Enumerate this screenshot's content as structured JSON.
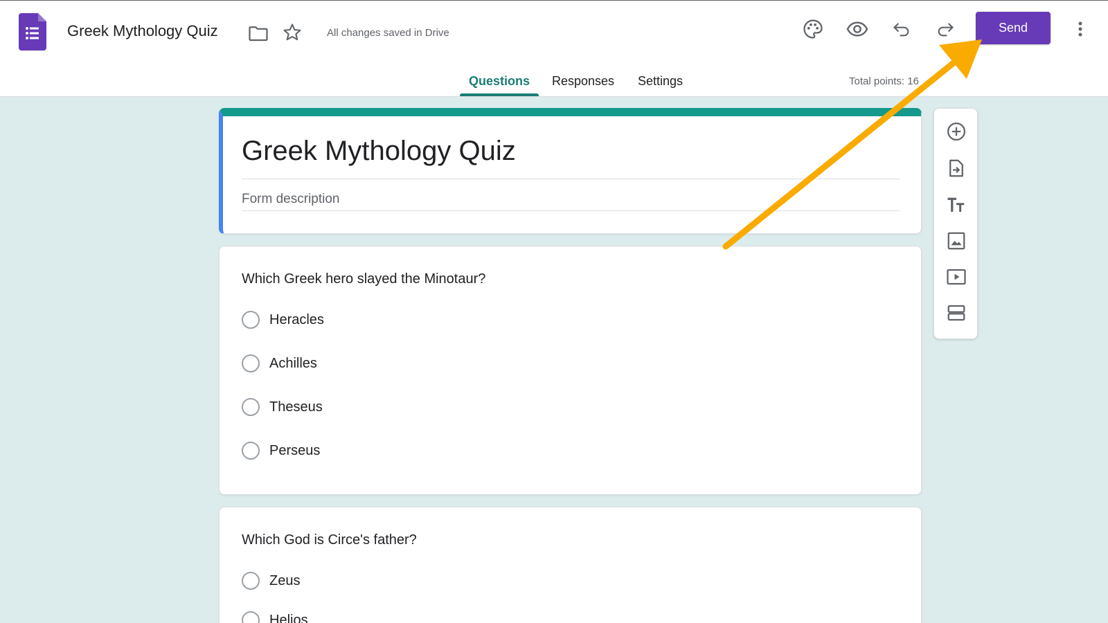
{
  "app": {
    "doc_title": "Greek Mythology Quiz",
    "save_status": "All changes saved in Drive",
    "send_label": "Send",
    "brand_color": "#673ab7",
    "accent_color": "#1a7d74",
    "toolbar_icons": [
      "palette-icon",
      "preview-eye-icon",
      "undo-icon",
      "redo-icon",
      "more-vert-icon"
    ]
  },
  "tabs": {
    "questions": "Questions",
    "responses": "Responses",
    "settings": "Settings",
    "active": "Questions",
    "total_points": "Total points: 16"
  },
  "form": {
    "title": "Greek Mythology Quiz",
    "description_placeholder": "Form description"
  },
  "questions": [
    {
      "text": "Which Greek hero slayed the Minotaur?",
      "options": [
        "Heracles",
        "Achilles",
        "Theseus",
        "Perseus"
      ]
    },
    {
      "text": "Which God is Circe's father?",
      "options": [
        "Zeus",
        "Helios"
      ]
    }
  ],
  "side_toolbar": {
    "icons": [
      "add-question-icon",
      "import-questions-icon",
      "add-title-icon",
      "add-image-icon",
      "add-video-icon",
      "add-section-icon"
    ]
  },
  "annotation": {
    "arrow_color": "#f9ab00",
    "points_to": "send-button"
  }
}
